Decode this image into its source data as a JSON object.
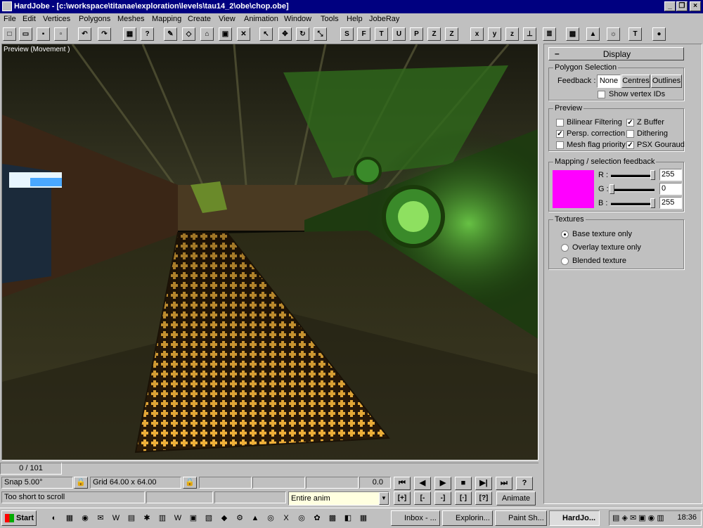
{
  "window": {
    "title": "HardJobe - [c:\\workspace\\titanae\\exploration\\levels\\tau14_2\\obe\\chop.obe]",
    "min_label": "_",
    "restore_label": "❐",
    "close_label": "×"
  },
  "menu": [
    "File",
    "Edit",
    "Vertices",
    "Polygons",
    "Meshes",
    "Mapping",
    "Create",
    "View",
    "Animation",
    "Window",
    "Tools",
    "Help",
    "JobeRay"
  ],
  "toolbar": {
    "buttons": [
      {
        "name": "new-file-icon",
        "glyph": "□"
      },
      {
        "name": "open-folder-icon",
        "glyph": "▭"
      },
      {
        "name": "save-icon",
        "glyph": "▪"
      },
      {
        "name": "save-all-icon",
        "glyph": "▫"
      },
      {
        "name": "undo-icon",
        "glyph": "↶"
      },
      {
        "name": "redo-icon",
        "glyph": "↷"
      },
      {
        "name": "grid-icon",
        "glyph": "▦"
      },
      {
        "name": "help-icon",
        "glyph": "?"
      },
      {
        "name": "pen-icon",
        "glyph": "✎"
      },
      {
        "name": "polygon-icon",
        "glyph": "◇"
      },
      {
        "name": "house-icon",
        "glyph": "⌂"
      },
      {
        "name": "cube-icon",
        "glyph": "▣"
      },
      {
        "name": "cross-tool-icon",
        "glyph": "✕"
      },
      {
        "name": "select-arrow-icon",
        "glyph": "↖"
      },
      {
        "name": "move-icon",
        "glyph": "✥"
      },
      {
        "name": "rotate-icon",
        "glyph": "↻"
      },
      {
        "name": "scale-icon",
        "glyph": "⤡"
      },
      {
        "name": "mode-s-icon",
        "glyph": "S"
      },
      {
        "name": "mode-f-icon",
        "glyph": "F"
      },
      {
        "name": "mode-t-icon",
        "glyph": "T"
      },
      {
        "name": "mode-u-icon",
        "glyph": "U"
      },
      {
        "name": "mode-p-icon",
        "glyph": "P"
      },
      {
        "name": "mode-zu-icon",
        "glyph": "Z"
      },
      {
        "name": "mode-zm-icon",
        "glyph": "Z"
      },
      {
        "name": "axis-x-icon",
        "glyph": "x"
      },
      {
        "name": "axis-y-icon",
        "glyph": "y"
      },
      {
        "name": "axis-z-icon",
        "glyph": "z"
      },
      {
        "name": "axis-xy-icon",
        "glyph": "⊥"
      },
      {
        "name": "document-panel-icon",
        "glyph": "≣"
      },
      {
        "name": "texture-panel-icon",
        "glyph": "▩"
      },
      {
        "name": "cone-panel-icon",
        "glyph": "▲"
      },
      {
        "name": "light-bulb-icon",
        "glyph": "☼"
      },
      {
        "name": "hammer-icon",
        "glyph": "T"
      },
      {
        "name": "sphere-icon",
        "glyph": "●"
      }
    ]
  },
  "viewport": {
    "label": "Preview (Movement )"
  },
  "panel": {
    "collapse_label": "–",
    "header": "Display",
    "polygon_selection": {
      "title": "Polygon Selection",
      "feedback_label": "Feedback :",
      "buttons": [
        "None",
        "Centres",
        "Outlines"
      ],
      "show_vertex_ids": "Show vertex IDs"
    },
    "preview": {
      "title": "Preview",
      "options": [
        {
          "label": "Bilinear Filtering",
          "checked": false
        },
        {
          "label": "Z Buffer",
          "checked": true
        },
        {
          "label": "Persp. correction",
          "checked": true
        },
        {
          "label": "Dithering",
          "checked": false
        },
        {
          "label": "Mesh flag priority",
          "checked": false
        },
        {
          "label": "PSX Gouraud",
          "checked": true
        }
      ]
    },
    "mapping": {
      "title": "Mapping / selection feedback",
      "swatch_color": "#ff00ff",
      "r_label": "R :",
      "g_label": "G :",
      "b_label": "B :",
      "r": "255",
      "g": "0",
      "b": "255",
      "r_level": 1.0,
      "g_level": 0.0,
      "b_level": 1.0
    },
    "textures": {
      "title": "Textures",
      "options": [
        {
          "label": "Base texture only",
          "selected": true
        },
        {
          "label": "Overlay texture only",
          "selected": false
        },
        {
          "label": "Blended texture",
          "selected": false
        }
      ]
    }
  },
  "timeline": {
    "frame": "0 / 101"
  },
  "status": {
    "snap": "Snap 5.00°",
    "grid": "Grid 64.00 x 64.00",
    "time": "0.0",
    "message": "Too short to scroll",
    "range": "Entire anim",
    "animate": "Animate",
    "lock_glyph": "🔒"
  },
  "playback": {
    "top": [
      "⏮",
      "◀",
      "▶",
      "■",
      "▶|",
      "⏭",
      "?"
    ],
    "bottom": [
      "[+]",
      "[-",
      "-]",
      "[·]",
      "[?]"
    ]
  },
  "taskbar": {
    "start": "Start",
    "quick_launch": [
      "◐",
      "▦",
      "◉",
      "✉",
      "W",
      "▤",
      "✱",
      "▥",
      "W",
      "▣",
      "▧",
      "◆",
      "⚙",
      "▲",
      "◎",
      "X",
      "◎",
      "✿",
      "▩",
      "◧",
      "▦"
    ],
    "tasks": [
      "Inbox - ...",
      "Explorin...",
      "Paint Sh...",
      "HardJo..."
    ],
    "clock": "18:36"
  }
}
